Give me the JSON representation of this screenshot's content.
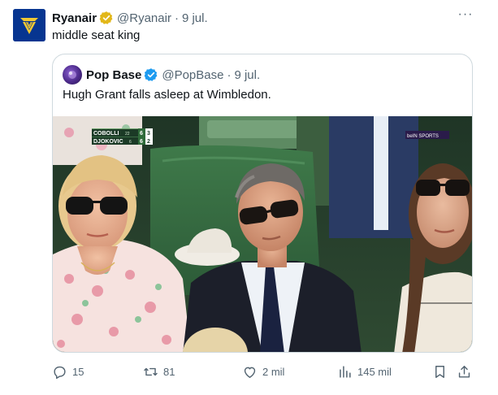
{
  "tweet": {
    "author_name": "Ryanair",
    "author_handle": "@Ryanair",
    "separator": "·",
    "time": "9 jul.",
    "text": "middle seat king",
    "more_label": "···"
  },
  "quoted": {
    "author_name": "Pop Base",
    "author_handle": "@PopBase",
    "separator": "·",
    "time": "9 jul.",
    "text": "Hugh Grant falls asleep at Wimbledon.",
    "scoreboard": {
      "player1": "COBOLLI",
      "seed1": "22",
      "set1_p1": "6",
      "games_p1": "3",
      "player2": "DJOKOVIC",
      "seed2": "6",
      "set1_p2": "6",
      "games_p2": "2"
    },
    "broadcast_badge": "beIN SPORTS"
  },
  "actions": {
    "replies": "15",
    "reposts": "81",
    "likes": "2 mil",
    "views": "145 mil"
  },
  "colors": {
    "text_primary": "#0f1419",
    "text_secondary": "#536471",
    "border": "#cfd9de",
    "verified_gold": "#e2b719",
    "verified_blue": "#1d9bf0",
    "ryanair_blue": "#073590",
    "ryanair_gold": "#f1c933"
  }
}
